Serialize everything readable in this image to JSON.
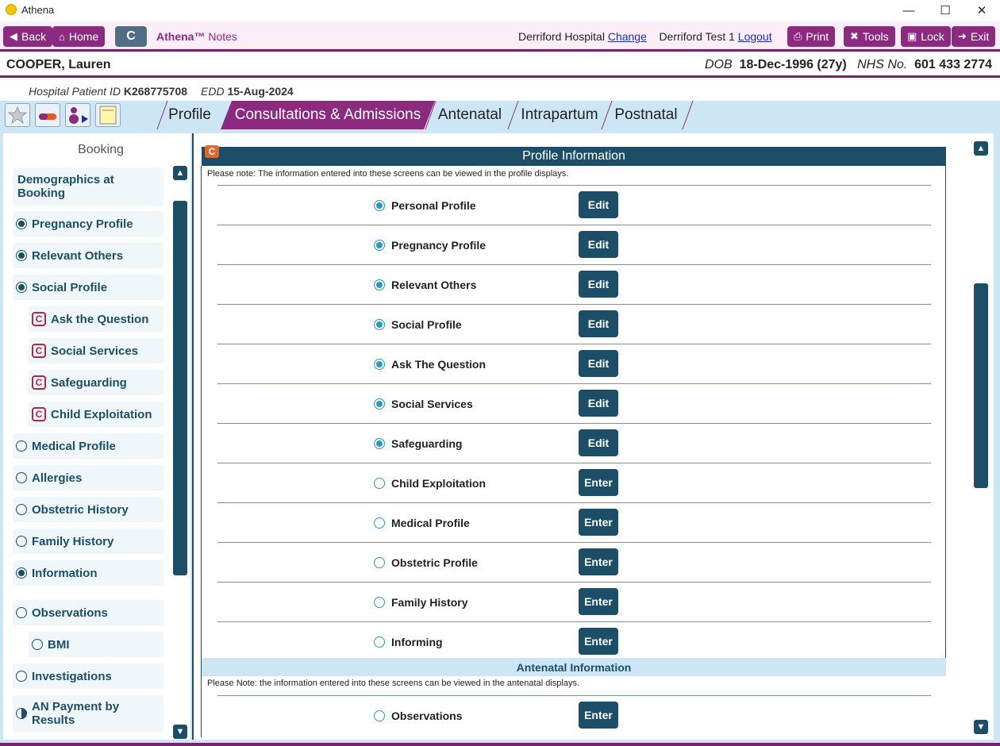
{
  "window": {
    "title": "Athena",
    "minimize": "—",
    "maximize": "☐",
    "close": "✕"
  },
  "topnav": {
    "back": "Back",
    "home": "Home",
    "c": "C",
    "brand": "Athena™",
    "brand_sub": "Notes",
    "hospital": "Derriford Hospital",
    "change": "Change",
    "user": "Derriford Test 1",
    "logout": "Logout",
    "print": "Print",
    "tools": "Tools",
    "lock": "Lock",
    "exit": "Exit"
  },
  "patient": {
    "name": "COOPER, Lauren",
    "dob_label": "DOB",
    "dob": "18-Dec-1996 (27y)",
    "nhs_label": "NHS No.",
    "nhs": "601 433 2774",
    "hpid_label": "Hospital Patient ID",
    "hpid": "K268775708",
    "edd_label": "EDD",
    "edd": "15-Aug-2024"
  },
  "tabs": [
    {
      "label": "Profile",
      "active": false
    },
    {
      "label": "Consultations & Admissions",
      "active": true
    },
    {
      "label": "Antenatal",
      "active": false
    },
    {
      "label": "Intrapartum",
      "active": false
    },
    {
      "label": "Postnatal",
      "active": false
    }
  ],
  "sidebar": {
    "title": "Booking",
    "items": [
      {
        "label": "Demographics at Booking",
        "marker": "none"
      },
      {
        "label": "Pregnancy Profile",
        "marker": "filled"
      },
      {
        "label": "Relevant Others",
        "marker": "filled"
      },
      {
        "label": "Social Profile",
        "marker": "filled"
      },
      {
        "label": "Ask the Question",
        "marker": "c"
      },
      {
        "label": "Social Services",
        "marker": "c"
      },
      {
        "label": "Safeguarding",
        "marker": "c"
      },
      {
        "label": "Child Exploitation",
        "marker": "c"
      },
      {
        "label": "Medical Profile",
        "marker": "empty"
      },
      {
        "label": "Allergies",
        "marker": "empty"
      },
      {
        "label": "Obstetric History",
        "marker": "empty"
      },
      {
        "label": "Family History",
        "marker": "empty"
      },
      {
        "label": "Information",
        "marker": "filled"
      },
      {
        "label": "Observations",
        "marker": "empty"
      },
      {
        "label": "BMI",
        "marker": "empty"
      },
      {
        "label": "Investigations",
        "marker": "empty"
      },
      {
        "label": "AN Payment by Results",
        "marker": "half"
      }
    ]
  },
  "main": {
    "c_badge": "C",
    "section_title": "Profile Information",
    "note": "Please note: The information entered into these screens can be viewed in the profile displays.",
    "rows": [
      {
        "label": "Personal Profile",
        "filled": true,
        "action": "Edit"
      },
      {
        "label": "Pregnancy Profile",
        "filled": true,
        "action": "Edit"
      },
      {
        "label": "Relevant Others",
        "filled": true,
        "action": "Edit"
      },
      {
        "label": "Social Profile",
        "filled": true,
        "action": "Edit"
      },
      {
        "label": "Ask The Question",
        "filled": true,
        "action": "Edit"
      },
      {
        "label": "Social Services",
        "filled": true,
        "action": "Edit"
      },
      {
        "label": "Safeguarding",
        "filled": true,
        "action": "Edit"
      },
      {
        "label": "Child Exploitation",
        "filled": false,
        "action": "Enter"
      },
      {
        "label": "Medical Profile",
        "filled": false,
        "action": "Enter"
      },
      {
        "label": "Obstetric Profile",
        "filled": false,
        "action": "Enter"
      },
      {
        "label": "Family History",
        "filled": false,
        "action": "Enter"
      },
      {
        "label": "Informing",
        "filled": false,
        "action": "Enter"
      }
    ],
    "antenatal_title": "Antenatal Information",
    "antenatal_note": "Please Note: the information entered into these screens can be viewed in the antenatal displays.",
    "antenatal_rows": [
      {
        "label": "Observations",
        "filled": false,
        "action": "Enter"
      }
    ]
  }
}
